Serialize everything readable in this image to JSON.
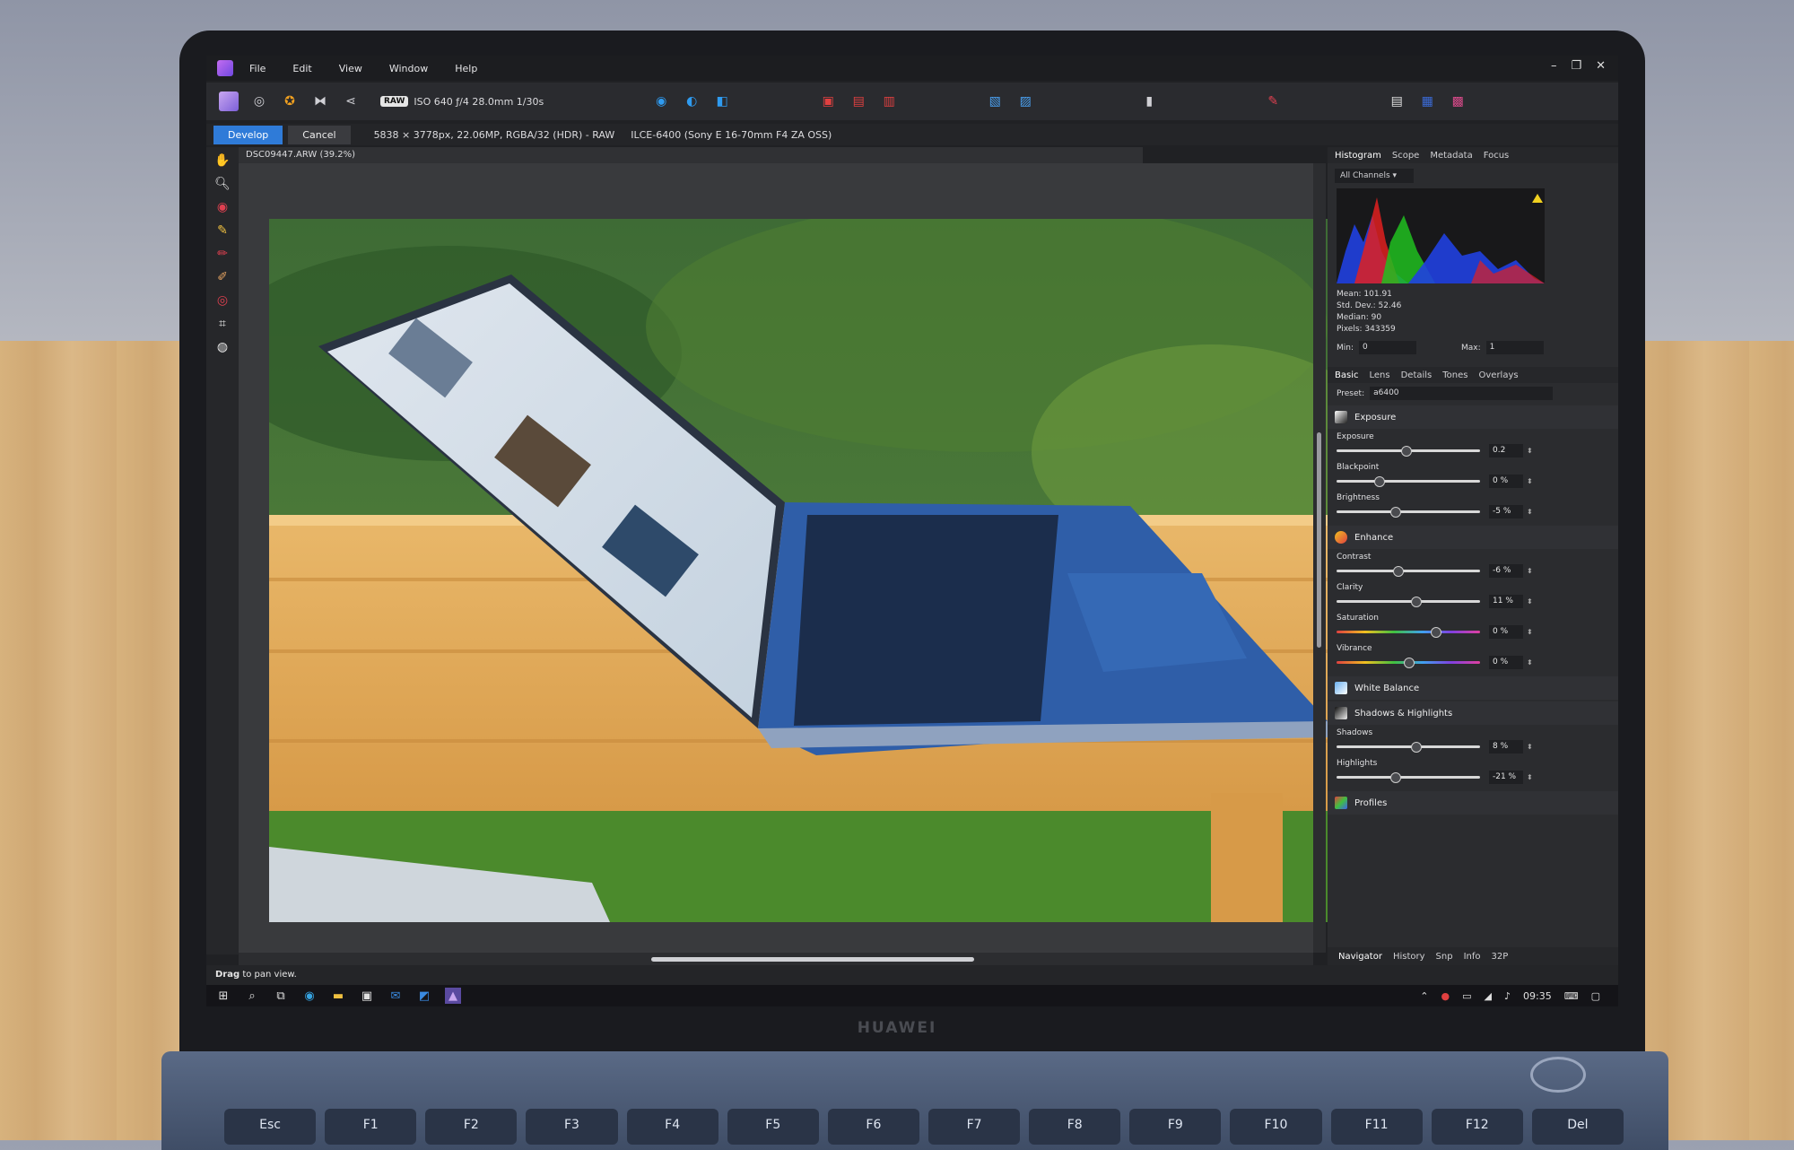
{
  "menubar": {
    "items": [
      "File",
      "Edit",
      "View",
      "Window",
      "Help"
    ],
    "window_controls": [
      "–",
      "❐",
      "✕"
    ]
  },
  "toolbar": {
    "raw_badge": "RAW",
    "exif": "ISO 640 ƒ/4 28.0mm 1/30s"
  },
  "context": {
    "develop": "Develop",
    "cancel": "Cancel",
    "image_info": "5838 × 3778px, 22.06MP, RGBA/32 (HDR) - RAW",
    "camera": "ILCE-6400 (Sony E 16-70mm F4 ZA OSS)"
  },
  "document": {
    "tab_title": "DSC09447.ARW (39.2%)"
  },
  "panel": {
    "top_tabs": [
      "Histogram",
      "Scope",
      "Metadata",
      "Focus"
    ],
    "channel_select": "All Channels",
    "stats": [
      "Mean: 101.91",
      "Std. Dev.: 52.46",
      "Median: 90",
      "Pixels: 343359"
    ],
    "min_label": "Min:",
    "min_value": "0",
    "max_label": "Max:",
    "max_value": "1",
    "section_tabs": [
      "Basic",
      "Lens",
      "Details",
      "Tones",
      "Overlays"
    ],
    "preset_label": "Preset:",
    "preset_value": "a6400",
    "exposure_section": "Exposure",
    "enhance_section": "Enhance",
    "white_balance": "White Balance",
    "shadows_highlights": "Shadows & Highlights",
    "profiles": "Profiles",
    "sliders": [
      {
        "label": "Exposure",
        "value": "0.2",
        "position": 0.48
      },
      {
        "label": "Blackpoint",
        "value": "0 %",
        "position": 0.28
      },
      {
        "label": "Brightness",
        "value": "-5 %",
        "position": 0.4
      },
      {
        "label": "Contrast",
        "value": "-6 %",
        "position": 0.42
      },
      {
        "label": "Clarity",
        "value": "11 %",
        "position": 0.55
      },
      {
        "label": "Saturation",
        "value": "0 %",
        "position": 0.7
      },
      {
        "label": "Vibrance",
        "value": "0 %",
        "position": 0.5
      },
      {
        "label": "Shadows",
        "value": "8 %",
        "position": 0.55
      },
      {
        "label": "Highlights",
        "value": "-21 %",
        "position": 0.4
      }
    ],
    "bottom_tabs": [
      "Navigator",
      "History",
      "Snp",
      "Info",
      "32P"
    ]
  },
  "status": {
    "bold": "Drag",
    "text": " to pan view."
  },
  "taskbar": {
    "clock": "09:35"
  },
  "hardware": {
    "brand": "HUAWEI",
    "keys": [
      "Esc",
      "F1",
      "F2",
      "F3",
      "F4",
      "F5",
      "F6",
      "F7",
      "F8",
      "F9",
      "F10",
      "F11",
      "F12",
      "Del"
    ]
  },
  "colors": {
    "accent": "#2f7bd8"
  }
}
